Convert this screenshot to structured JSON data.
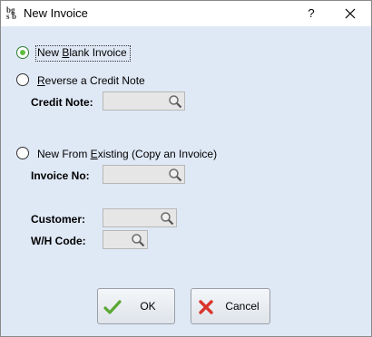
{
  "window": {
    "title": "New Invoice",
    "help_label": "?"
  },
  "options": {
    "new_blank": {
      "label_pre": "New ",
      "label_ul": "B",
      "label_post": "lank Invoice",
      "selected": true
    },
    "reverse_credit": {
      "label_pre": "",
      "label_ul": "R",
      "label_post": "everse a Credit Note",
      "selected": false
    },
    "new_from_existing": {
      "label_pre": "New From ",
      "label_ul": "E",
      "label_post": "xisting (Copy an Invoice)",
      "selected": false
    }
  },
  "fields": {
    "credit_note_label": "Credit Note:",
    "invoice_no_label": "Invoice No:",
    "customer_label": "Customer:",
    "wh_code_label": "W/H Code:"
  },
  "buttons": {
    "ok_label": "OK",
    "cancel_label": "Cancel"
  },
  "colors": {
    "client_bg": "#dfe8f5",
    "ok_check": "#5aa832",
    "cancel_x": "#d9342b"
  },
  "icons": {
    "app": "app-logo-icon",
    "search": "magnifier-icon",
    "ok": "green-check-icon",
    "cancel": "red-x-icon"
  }
}
